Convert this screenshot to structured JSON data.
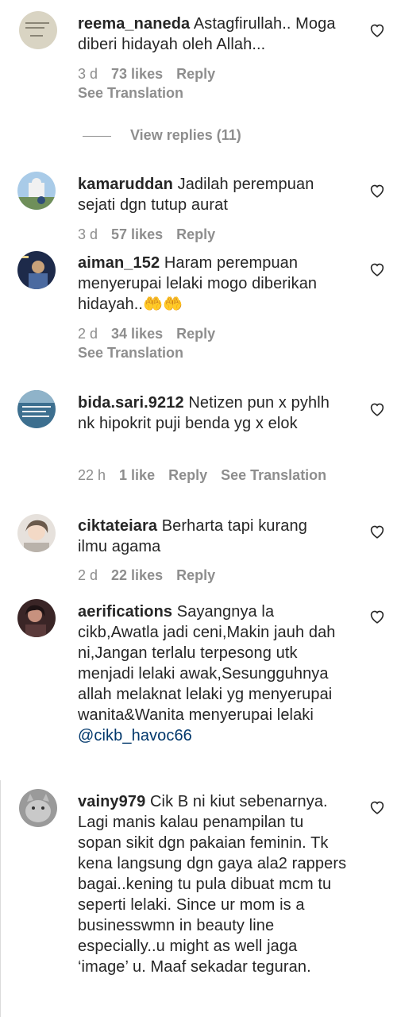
{
  "comments": [
    {
      "username": "reema_naneda",
      "text": "Astagfirullah.. Moga diberi hidayah oleh Allah...",
      "time": "3 d",
      "likes": "73 likes",
      "reply": "Reply",
      "see_translation": "See Translation",
      "view_replies": "View replies (11)"
    },
    {
      "username": "kamaruddan",
      "text": "Jadilah perempuan sejati dgn tutup aurat",
      "time": "3 d",
      "likes": "57 likes",
      "reply": "Reply"
    },
    {
      "username": "aiman_152",
      "text": "Haram perempuan menyerupai lelaki mogo diberikan hidayah..",
      "emoji": "🤲🤲",
      "time": "2 d",
      "likes": "34 likes",
      "reply": "Reply",
      "see_translation": "See Translation"
    },
    {
      "username": "bida.sari.9212",
      "text": "Netizen pun x pyhlh nk hipokrit puji benda yg x elok",
      "time": "22 h",
      "likes": "1 like",
      "reply": "Reply",
      "see_translation": "See Translation"
    },
    {
      "username": "ciktateiara",
      "text": "Berharta tapi kurang ilmu agama",
      "time": "2 d",
      "likes": "22 likes",
      "reply": "Reply"
    },
    {
      "username": "aerifications",
      "text": "Sayangnya la cikb,Awatla jadi ceni,Makin jauh dah ni,Jangan terlalu terpesong utk menjadi lelaki awak,Sesungguhnya allah melaknat lelaki yg menyerupai wanita&Wanita menyerupai lelaki",
      "mention": "@cikb_havoc66"
    },
    {
      "username": "vainy979",
      "text": "Cik B ni kiut sebenarnya. Lagi manis kalau penampilan tu sopan sikit dgn pakaian feminin. Tk kena langsung dgn gaya ala2 rappers bagai..kening tu pula dibuat mcm tu seperti lelaki. Since ur mom is a businesswmn in beauty line especially..u might as well jaga ‘image’ u. Maaf sekadar teguran."
    }
  ],
  "icons": {
    "like": "heart-outline-icon"
  },
  "colors": {
    "text": "#262626",
    "secondary": "#8e8e8e",
    "mention": "#00376b"
  }
}
